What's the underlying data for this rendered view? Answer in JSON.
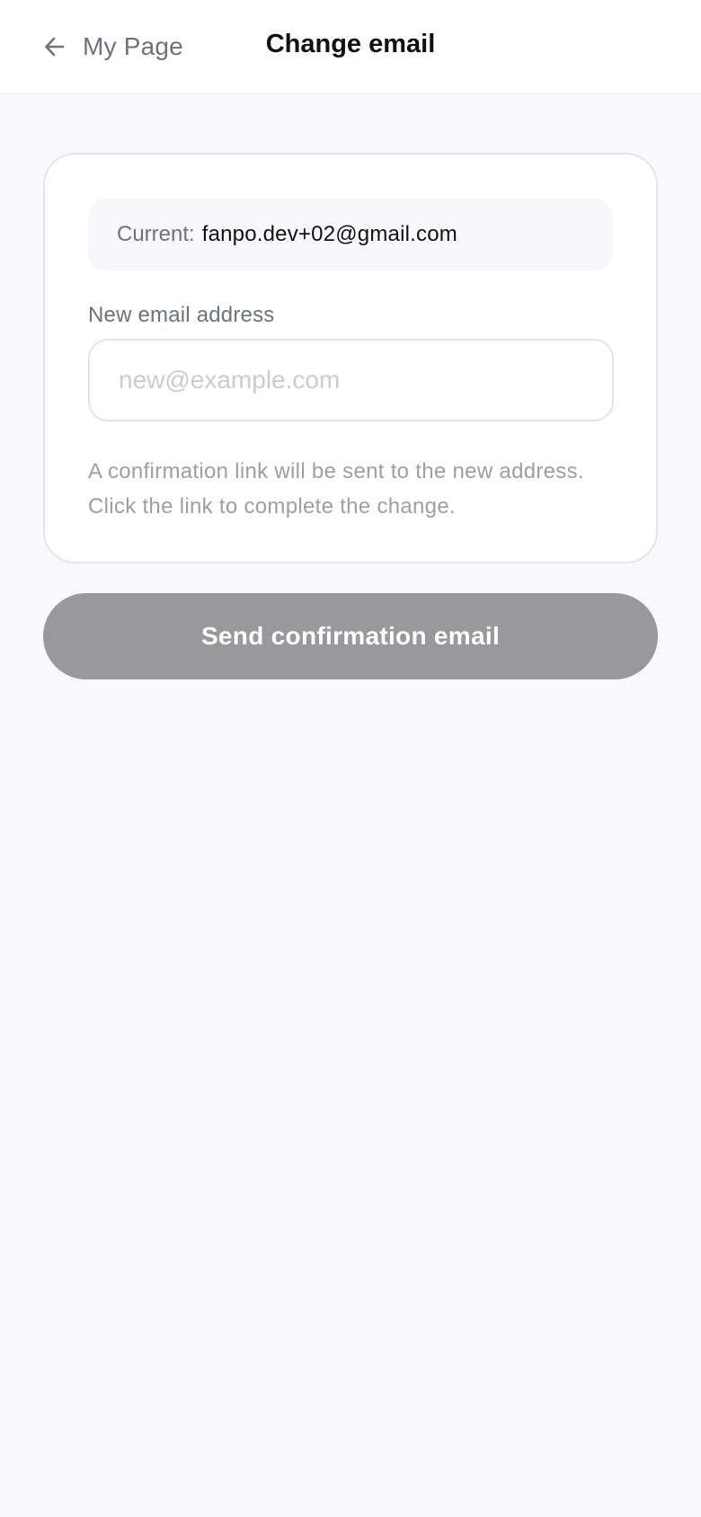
{
  "header": {
    "back_label": "My Page",
    "back_icon": "arrow-left-icon",
    "title": "Change email"
  },
  "current": {
    "label": "Current:",
    "value": "fanpo.dev+02@gmail.com"
  },
  "form": {
    "field_label": "New email address",
    "input_value": "",
    "input_placeholder": "new@example.com",
    "hint_line1": "A confirmation link will be sent to the new address.",
    "hint_line2": "Click the link to complete the change."
  },
  "actions": {
    "send_label": "Send confirmation email"
  },
  "colors": {
    "background": "#f8f9fb",
    "button_disabled": "#98999b",
    "muted_text": "#6b7280",
    "hint_text": "#9aa0a8"
  }
}
